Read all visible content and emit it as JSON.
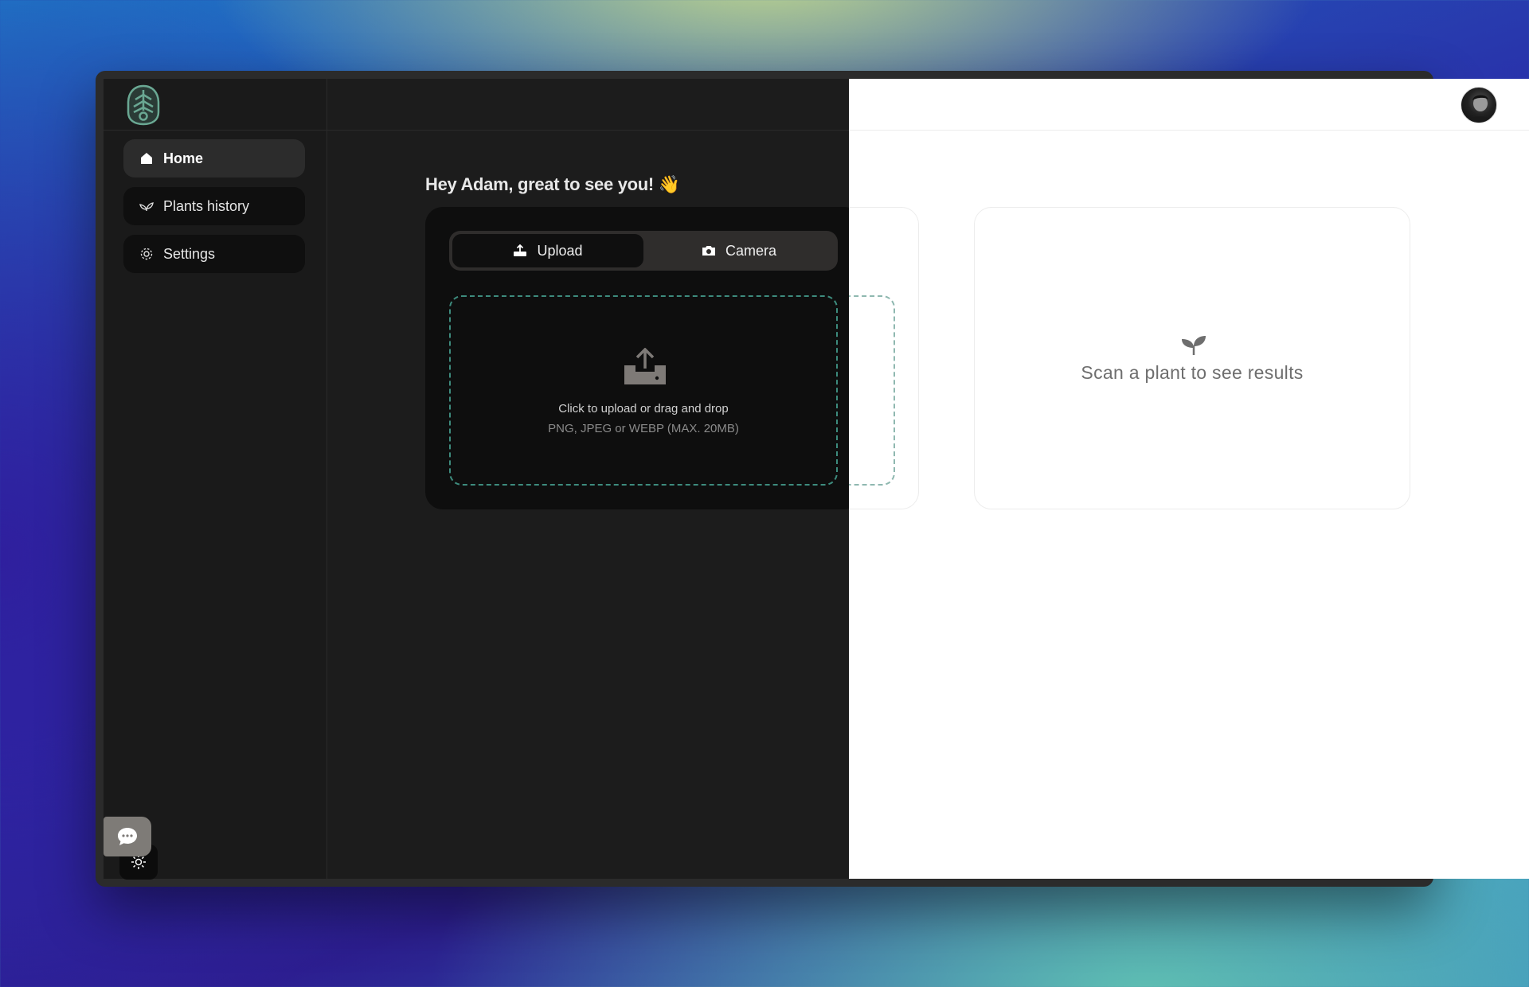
{
  "sidebar": {
    "items": [
      {
        "label": "Home",
        "icon": "home-icon",
        "active": true
      },
      {
        "label": "Plants history",
        "icon": "leaf-icon",
        "active": false
      },
      {
        "label": "Settings",
        "icon": "gear-icon",
        "active": false
      }
    ]
  },
  "main": {
    "greeting": "Hey Adam, great to see you! 👋",
    "tabs": [
      {
        "label": "Upload",
        "icon": "upload-icon",
        "active": true
      },
      {
        "label": "Camera",
        "icon": "camera-icon",
        "active": false
      }
    ],
    "dropzone": {
      "title": "Click to upload or drag and drop",
      "subtitle": "PNG, JPEG or WEBP (MAX. 20MB)"
    },
    "results": {
      "empty_text": "Scan a plant to see results"
    }
  },
  "colors": {
    "dark_bg": "#1c1c1c",
    "sidebar_bg": "#1a1a1a",
    "card_bg": "#0e0e0e",
    "accent_dashed": "#3d8b7d",
    "light_bg": "#ffffff"
  }
}
